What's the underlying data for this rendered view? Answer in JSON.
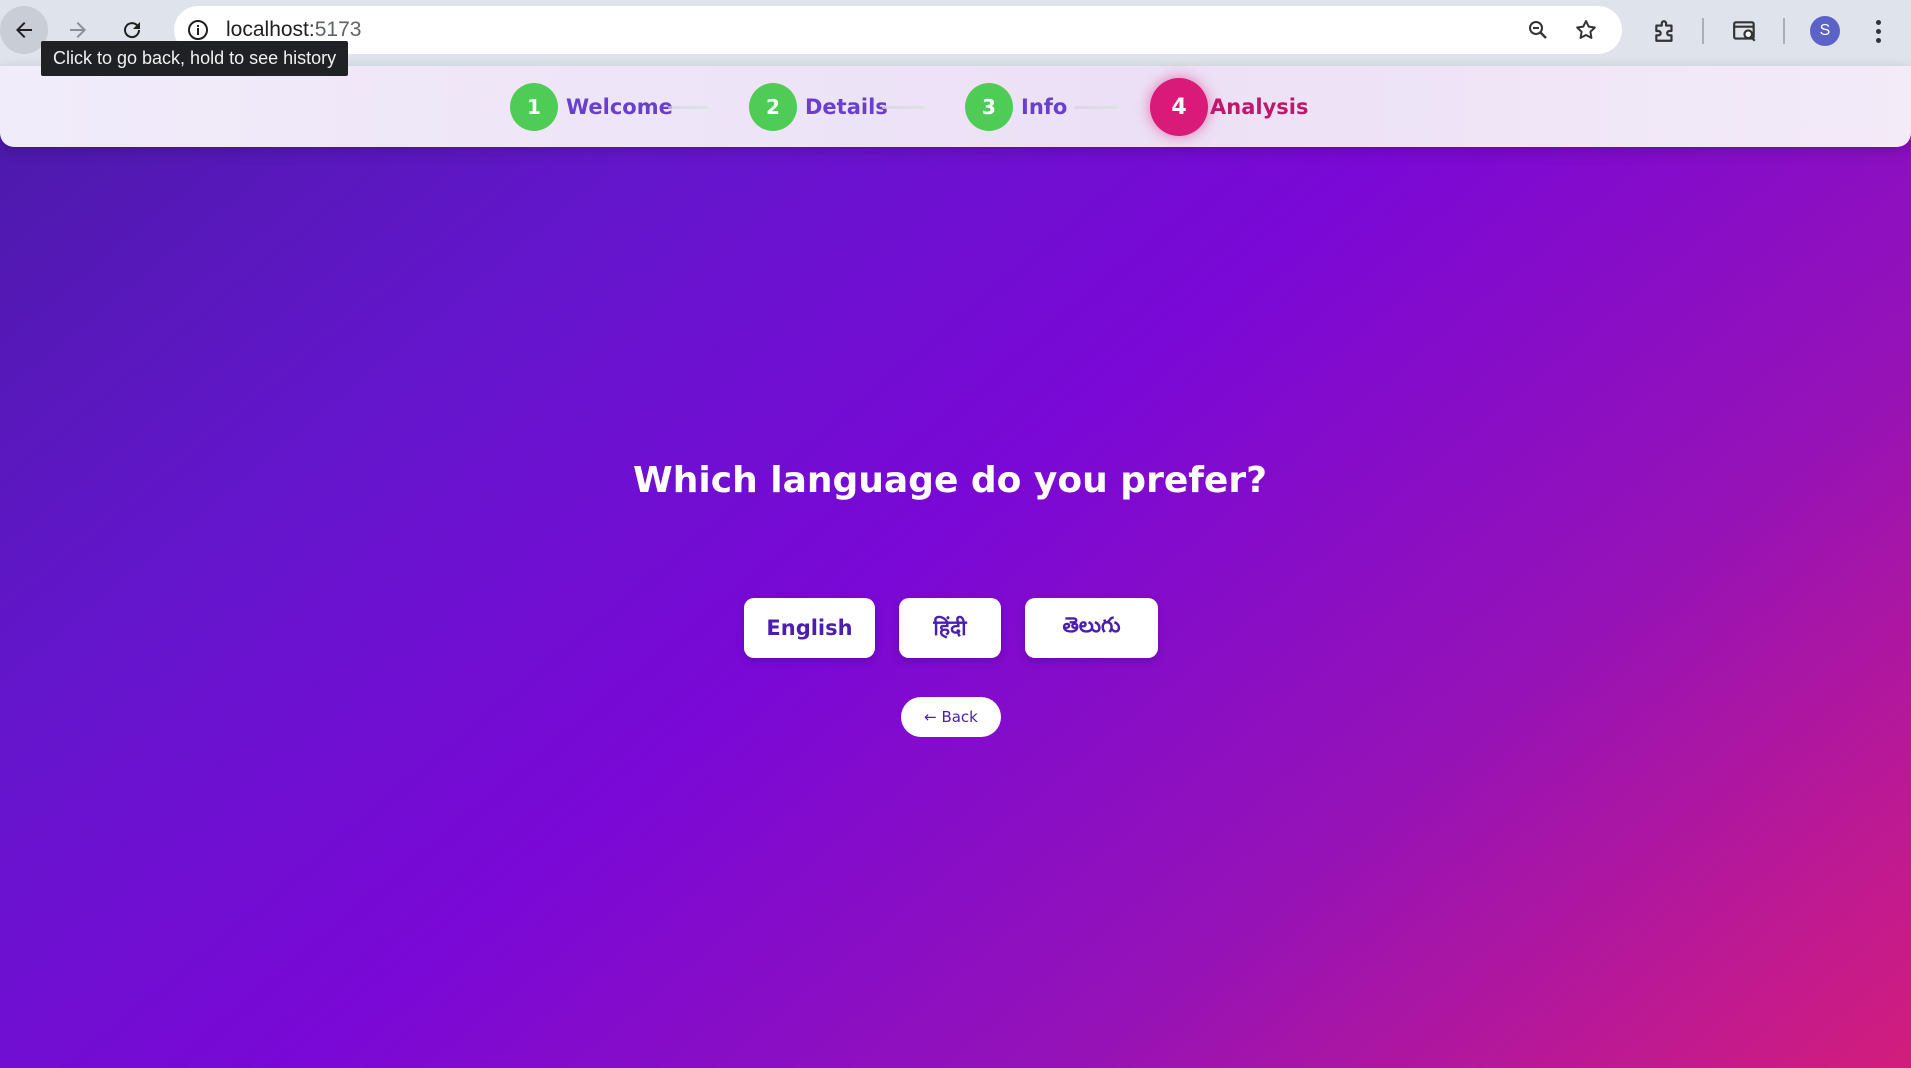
{
  "browser": {
    "url_host": "localhost:",
    "url_port": "5173",
    "tooltip": "Click to go back, hold to see history",
    "profile_initial": "S",
    "icons": [
      "back-arrow-icon",
      "forward-arrow-icon",
      "reload-icon",
      "site-info-icon",
      "zoom-icon",
      "bookmark-star-icon",
      "extensions-icon",
      "tab-search-icon",
      "more-menu-icon"
    ]
  },
  "stepper": {
    "steps": [
      {
        "number": "1",
        "label": "Welcome",
        "state": "complete"
      },
      {
        "number": "2",
        "label": "Details",
        "state": "complete"
      },
      {
        "number": "3",
        "label": "Info",
        "state": "complete"
      },
      {
        "number": "4",
        "label": "Analysis",
        "state": "active"
      }
    ],
    "colors": {
      "complete": "#4fcc55",
      "active": "#d91a78",
      "label": "#6a3fd0"
    }
  },
  "main": {
    "question": "Which language do you prefer?",
    "options": [
      "English",
      "हिंदी",
      "తెలుగు"
    ],
    "back_label": "← Back"
  }
}
